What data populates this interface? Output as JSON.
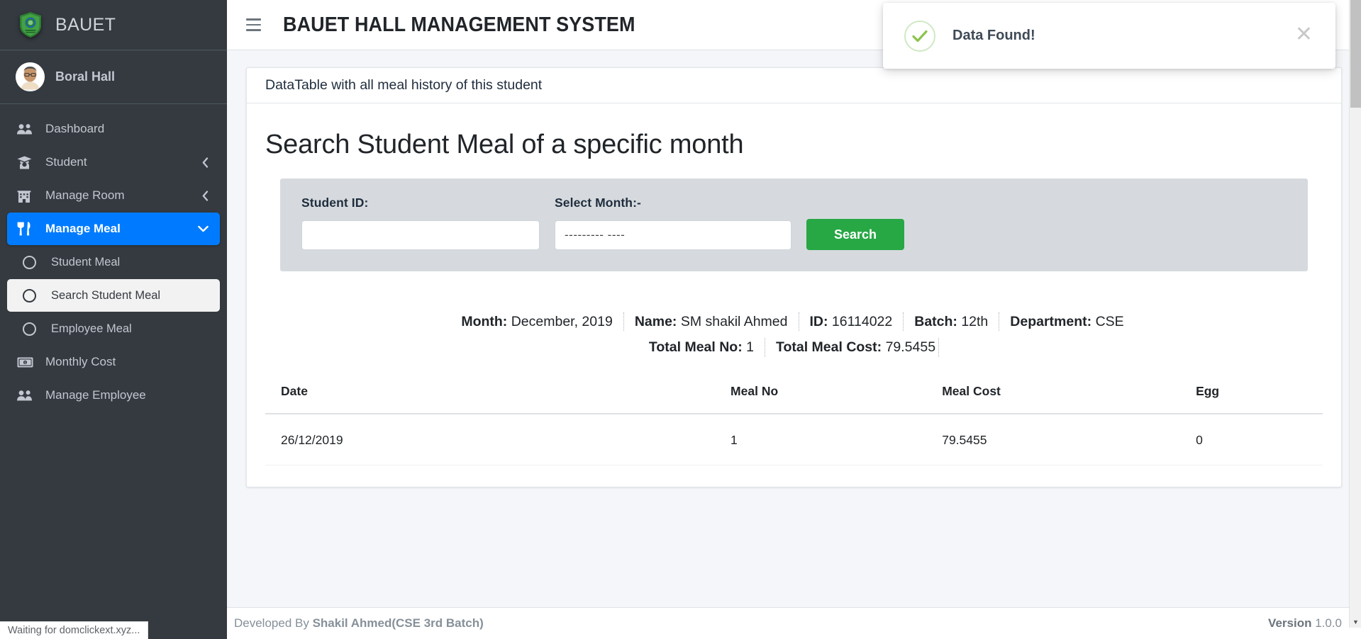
{
  "sidebar": {
    "brand": {
      "title": "BAUET",
      "logo_icon": "bauet-crest-logo"
    },
    "user": {
      "name": "Boral Hall",
      "avatar_icon": "user-avatar"
    },
    "items": [
      {
        "label": "Dashboard",
        "icon": "users-icon",
        "state": "normal"
      },
      {
        "label": "Student",
        "icon": "graduation-cap-icon",
        "state": "normal",
        "chevron": "chevron-left-icon"
      },
      {
        "label": "Manage Room",
        "icon": "building-icon",
        "state": "normal",
        "chevron": "chevron-left-icon"
      },
      {
        "label": "Manage Meal",
        "icon": "utensils-icon",
        "state": "active",
        "chevron": "chevron-down-icon"
      },
      {
        "label": "Student Meal",
        "icon": "circle-icon",
        "state": "sub"
      },
      {
        "label": "Search Student Meal",
        "icon": "circle-icon",
        "state": "sub-highlight"
      },
      {
        "label": "Employee Meal",
        "icon": "circle-icon",
        "state": "sub"
      },
      {
        "label": "Monthly Cost",
        "icon": "money-bill-icon",
        "state": "normal"
      },
      {
        "label": "Manage Employee",
        "icon": "users-icon",
        "state": "normal"
      }
    ]
  },
  "topbar": {
    "menu_icon": "hamburger-menu-icon",
    "title": "BAUET HALL MANAGEMENT SYSTEM"
  },
  "toast": {
    "message": "Data Found!",
    "icon": "check-circle-icon",
    "close_icon": "close-icon",
    "accent_color": "#8bc34a"
  },
  "card": {
    "header": "DataTable with all meal history of this student",
    "heading": "Search Student Meal of a specific month"
  },
  "form": {
    "student_id": {
      "label": "Student ID:",
      "value": "",
      "placeholder": ""
    },
    "month": {
      "label": "Select Month:-",
      "value": "",
      "placeholder": "--------- ----"
    },
    "search_button": "Search",
    "button_color": "#28a745"
  },
  "summary": {
    "row1": [
      {
        "label": "Month:",
        "value": "December, 2019"
      },
      {
        "label": "Name:",
        "value": "SM shakil Ahmed"
      },
      {
        "label": "ID:",
        "value": "16114022"
      },
      {
        "label": "Batch:",
        "value": "12th"
      },
      {
        "label": "Department:",
        "value": "CSE"
      }
    ],
    "row2": [
      {
        "label": "Total Meal No:",
        "value": "1"
      },
      {
        "label": "Total Meal Cost:",
        "value": "79.5455"
      }
    ]
  },
  "table": {
    "columns": [
      "Date",
      "Meal No",
      "Meal Cost",
      "Egg"
    ],
    "rows": [
      {
        "date": "26/12/2019",
        "meal_no": "1",
        "meal_cost": "79.5455",
        "egg": "0"
      }
    ]
  },
  "footer": {
    "developed_by_prefix": "Developed By ",
    "developed_by": "Shakil Ahmed(CSE 3rd Batch)",
    "version_label": "Version ",
    "version_value": "1.0.0"
  },
  "browser": {
    "status_text": "Waiting for domclickext.xyz..."
  }
}
